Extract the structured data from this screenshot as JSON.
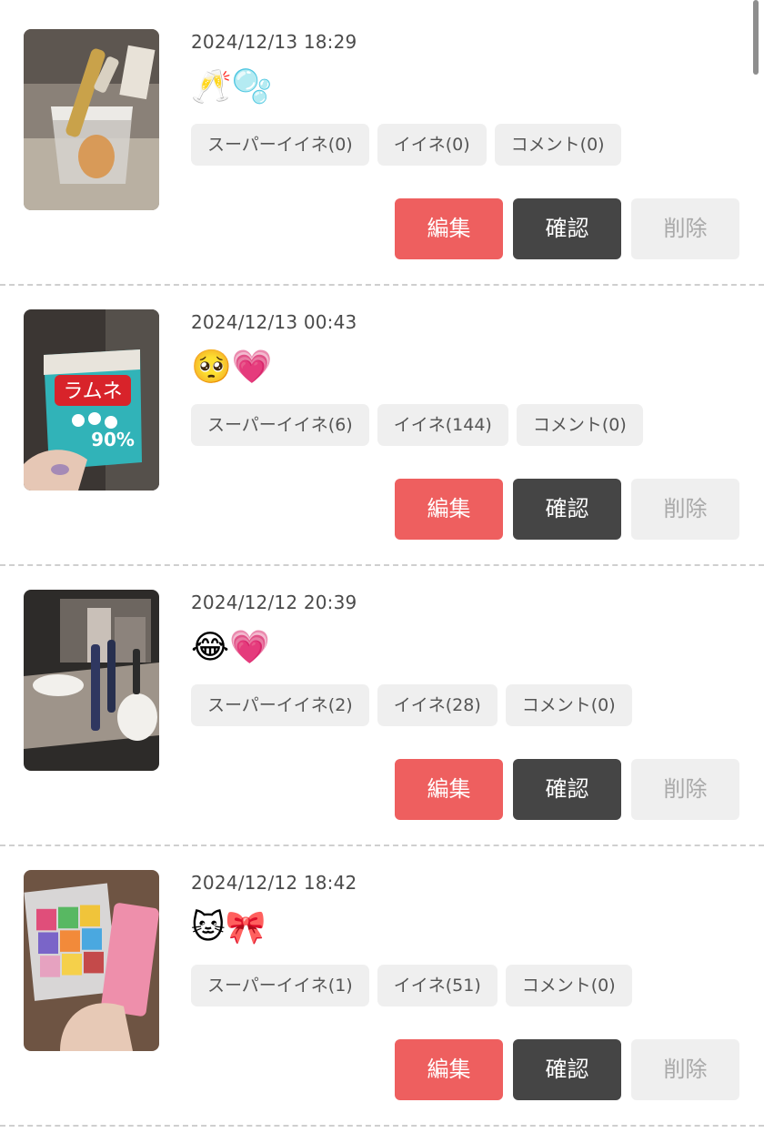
{
  "posts": [
    {
      "timestamp": "2024/12/13 18:29",
      "emoji": "🥂🫧",
      "super_like_label": "スーパーイイネ(0)",
      "like_label": "イイネ(0)",
      "comment_label": "コメント(0)",
      "edit_label": "編集",
      "confirm_label": "確認",
      "delete_label": "削除"
    },
    {
      "timestamp": "2024/12/13 00:43",
      "emoji": "🥺💗",
      "super_like_label": "スーパーイイネ(6)",
      "like_label": "イイネ(144)",
      "comment_label": "コメント(0)",
      "edit_label": "編集",
      "confirm_label": "確認",
      "delete_label": "削除",
      "photo_text_1": "ラムネ",
      "photo_text_2": "90%"
    },
    {
      "timestamp": "2024/12/12 20:39",
      "emoji": "😂💗",
      "super_like_label": "スーパーイイネ(2)",
      "like_label": "イイネ(28)",
      "comment_label": "コメント(0)",
      "edit_label": "編集",
      "confirm_label": "確認",
      "delete_label": "削除"
    },
    {
      "timestamp": "2024/12/12 18:42",
      "emoji": "🐱🎀",
      "super_like_label": "スーパーイイネ(1)",
      "like_label": "イイネ(51)",
      "comment_label": "コメント(0)",
      "edit_label": "編集",
      "confirm_label": "確認",
      "delete_label": "削除"
    }
  ],
  "colors": {
    "edit_button": "#ee5f5f",
    "confirm_button": "#454545",
    "delete_button": "#efefef",
    "chip_background": "#efefef"
  }
}
